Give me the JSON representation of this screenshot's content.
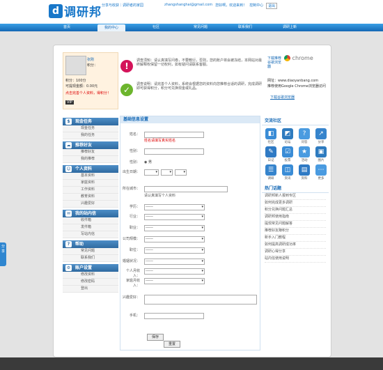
{
  "header": {
    "logo_mark": "d",
    "logo_text": "调研邦",
    "slogan": "分享与收获｜调研者的家园",
    "email": "zhangshanghai@gmail.com",
    "links": [
      "您好啊，欢迎来到！",
      "控制中心",
      "退出"
    ]
  },
  "nav": {
    "items": [
      "首页",
      "我的中心",
      "社区",
      "常见问题",
      "联系我们",
      "调研上新"
    ]
  },
  "profile": {
    "name": "张刚",
    "level_label": "积分：",
    "line3": "积分：100分",
    "line4": "可提现金额：0.00元",
    "link": "点击完善个人资料，得积分！",
    "badge": "VIP"
  },
  "notices": [
    "调查须知：请认真填写问卷，不要敷衍，否则，您的账户将会被冻结，本网站对最终解释权保留一切权利，如有疑问请联系客服。",
    "调查说明：请完善个人资料，系统会根据您的资料向您推荐合适的调研，完成调研即可获得积分，积分可兑换现金或礼品。"
  ],
  "rightbox": {
    "title": "下载推荐谷歌浏览器",
    "chrome": "chrome",
    "url": "网址：www.diaoyanbang.com",
    "desc": "推荐使用Google Chrome浏览器访问",
    "link": "下载谷歌浏览器"
  },
  "left_menu": [
    {
      "head": "现金任务",
      "icon": "$",
      "items": [
        "现金任务",
        "我的任务"
      ]
    },
    {
      "head": "推荐好友",
      "icon": "☁",
      "items": [
        "推荐好友",
        "我的推荐"
      ]
    },
    {
      "head": "个人资料",
      "icon": "☺",
      "items": [
        "基本资料",
        "家庭资料",
        "工作资料",
        "教育资料",
        "兴趣爱好"
      ]
    },
    {
      "head": "我的站内信",
      "icon": "✉",
      "items": [
        "收件箱",
        "发件箱",
        "写站内信"
      ]
    },
    {
      "head": "帮助",
      "icon": "?",
      "items": [
        "常见问题",
        "联系我们"
      ]
    },
    {
      "head": "账户设置",
      "icon": "⚙",
      "items": [
        "修改资料",
        "修改密码",
        "登出"
      ]
    }
  ],
  "form": {
    "title": "基础信息设置",
    "fields": [
      {
        "label": "姓名：",
        "value": ""
      },
      {
        "label": "性别：",
        "value": "男"
      },
      {
        "label": "出生日期：",
        "value": ""
      },
      {
        "label": "所在城市：",
        "value": ""
      },
      {
        "label": "学历：",
        "value": "------"
      },
      {
        "label": "行业：",
        "value": "------"
      },
      {
        "label": "职业：",
        "value": "------"
      },
      {
        "label": "公司规模：",
        "value": "------"
      },
      {
        "label": "职位：",
        "value": "------"
      },
      {
        "label": "婚姻状况：",
        "value": "------"
      },
      {
        "label": "个人月收入：",
        "value": "------"
      },
      {
        "label": "家庭月收入：",
        "value": "------"
      }
    ],
    "hint1": "姓名请填写真实姓名",
    "hint2": "请认真填写个人资料",
    "interest_label": "兴趣爱好：",
    "phone_label": "手机：",
    "save_label": "保存",
    "reset_label": "重置"
  },
  "side": {
    "title": "交流社区",
    "icons": [
      "社区",
      "论坛",
      "问答",
      "分享",
      "日记",
      "投票",
      "活动",
      "图片",
      "调研",
      "资讯",
      "资料",
      "更多"
    ],
    "hot_title": "热门话题",
    "hot": [
      "调研邦新人报到专区",
      "如何完成更多调研",
      "积分兑换问题汇总",
      "调研邦使用指南",
      "提现常见问题解答",
      "推荐好友赚积分",
      "新手入门教程",
      "如何提高调研成功率",
      "调研心得分享",
      "站内信使用说明"
    ]
  },
  "share": "分享"
}
